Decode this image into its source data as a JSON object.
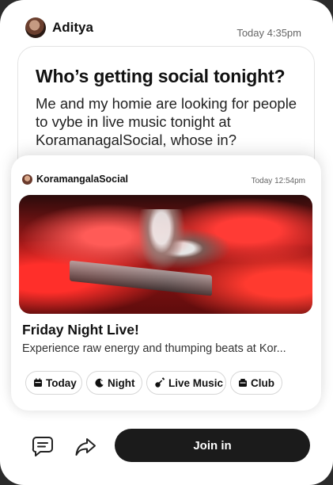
{
  "post": {
    "author": "Aditya",
    "time": "Today 4:35pm",
    "avatar_icon": "user-avatar",
    "title": "Who’s getting social tonight?",
    "body": "Me and my homie are looking for people to vybe in live music tonight at KoramanagalSocial, whose in?"
  },
  "event": {
    "venue": "KoramangalaSocial",
    "time": "Today 12:54pm",
    "image_icon": "concert-photo",
    "title": "Friday Night Live!",
    "description": "Experience raw energy and thumping beats at Kor..."
  },
  "tags": [
    {
      "label": "Today",
      "icon": "calendar-icon"
    },
    {
      "label": "Night",
      "icon": "moon-icon"
    },
    {
      "label": "Live Music",
      "icon": "guitar-icon"
    },
    {
      "label": "Club",
      "icon": "club-icon"
    }
  ],
  "actions": {
    "comment_icon": "comment-icon",
    "share_icon": "share-icon",
    "join_label": "Join in"
  },
  "colors": {
    "accent": "#1b1b1b",
    "photo_red": "#c01a1a"
  }
}
